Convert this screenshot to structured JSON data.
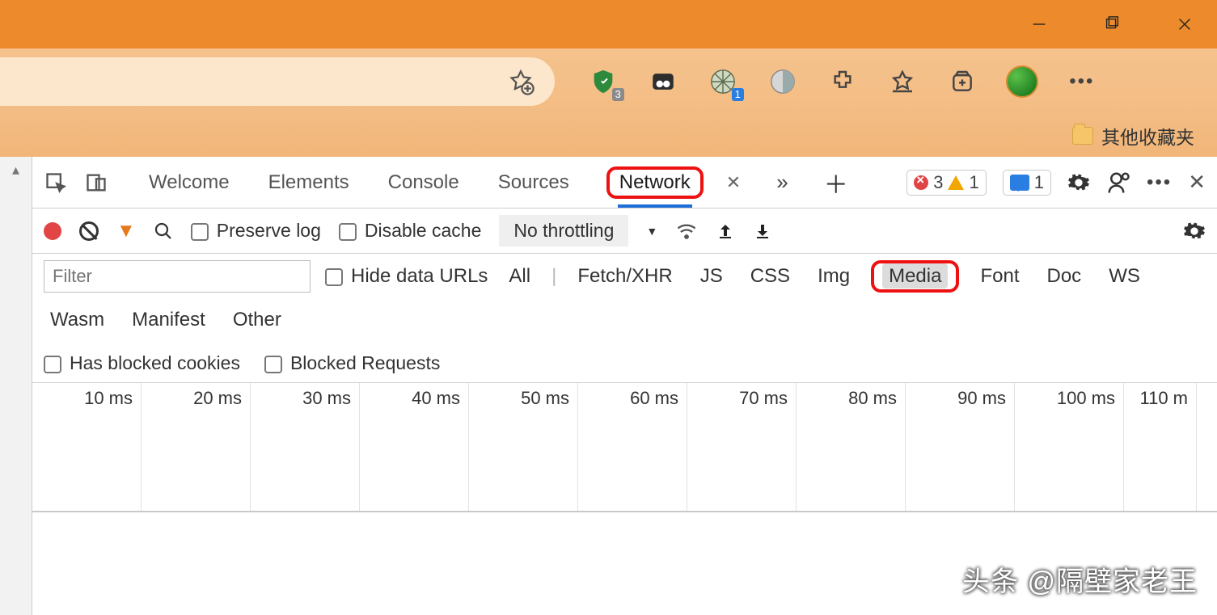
{
  "window": {
    "minimize": "–",
    "maximize": "❐",
    "close": "✕"
  },
  "extensions": {
    "shield_badge": "3",
    "wheel_badge": "1"
  },
  "bookmarks_bar": {
    "other_folder": "其他收藏夹"
  },
  "devtools": {
    "tabs": {
      "welcome": "Welcome",
      "elements": "Elements",
      "console": "Console",
      "sources": "Sources",
      "network": "Network"
    },
    "status": {
      "errors": "3",
      "warnings": "1",
      "messages": "1"
    },
    "toolbar": {
      "preserve_log": "Preserve log",
      "disable_cache": "Disable cache",
      "throttling": "No throttling"
    },
    "filter": {
      "placeholder": "Filter",
      "hide_data_urls": "Hide data URLs",
      "types": {
        "all": "All",
        "fetch": "Fetch/XHR",
        "js": "JS",
        "css": "CSS",
        "img": "Img",
        "media": "Media",
        "font": "Font",
        "doc": "Doc",
        "ws": "WS",
        "wasm": "Wasm",
        "manifest": "Manifest",
        "other": "Other"
      },
      "blocked_cookies": "Has blocked cookies",
      "blocked_requests": "Blocked Requests"
    },
    "timeline": [
      "10 ms",
      "20 ms",
      "30 ms",
      "40 ms",
      "50 ms",
      "60 ms",
      "70 ms",
      "80 ms",
      "90 ms",
      "100 ms",
      "110 m"
    ]
  },
  "watermark": "头条 @隔壁家老王"
}
